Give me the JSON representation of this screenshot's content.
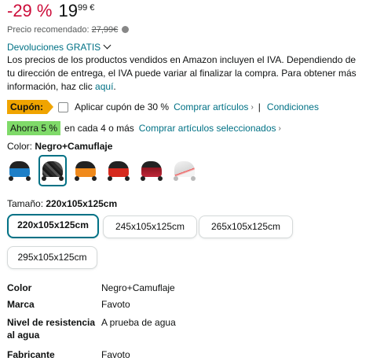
{
  "price": {
    "discount": "-29 %",
    "whole": "19",
    "fraction": "99 €",
    "recommended_label": "Precio recomendado:",
    "recommended_value": "27,99€"
  },
  "returns": {
    "label": "Devoluciones GRATIS"
  },
  "vat": {
    "text": "Los precios de los productos vendidos en Amazon incluyen el IVA. Dependiendo de tu dirección de entrega, el IVA puede variar al finalizar la compra. Para obtener más información, haz clic ",
    "link": "aquí",
    "end": "."
  },
  "coupon": {
    "badge": "Cupón:",
    "text": "Aplicar cupón de 30 %",
    "link": "Comprar artículos",
    "separator": "|",
    "conditions": "Condiciones"
  },
  "save": {
    "badge": "Ahorra 5 %",
    "text": "en cada 4 o más",
    "link": "Comprar artículos seleccionados"
  },
  "color": {
    "label": "Color:",
    "selected": "Negro+Camuflaje",
    "swatches": [
      {
        "name": "blue",
        "color": "#1e7fc7"
      },
      {
        "name": "camo",
        "color": "#3a3a3a"
      },
      {
        "name": "orange",
        "color": "#f08a1c"
      },
      {
        "name": "red",
        "color": "#d62a1e"
      },
      {
        "name": "dark-red",
        "color": "#8b1520"
      },
      {
        "name": "silver",
        "color": "#e9e9e9"
      }
    ]
  },
  "size": {
    "label": "Tamaño:",
    "selected": "220x105x125cm",
    "options": [
      "220x105x125cm",
      "245x105x125cm",
      "265x105x125cm",
      "295x105x125cm"
    ]
  },
  "specs": [
    {
      "key": "Color",
      "value": "Negro+Camuflaje"
    },
    {
      "key": "Marca",
      "value": "Favoto"
    },
    {
      "key": "Nivel de resistencia",
      "key2": "al agua",
      "value": "A prueba de agua"
    },
    {
      "key": "Fabricante",
      "value": "Favoto"
    }
  ]
}
